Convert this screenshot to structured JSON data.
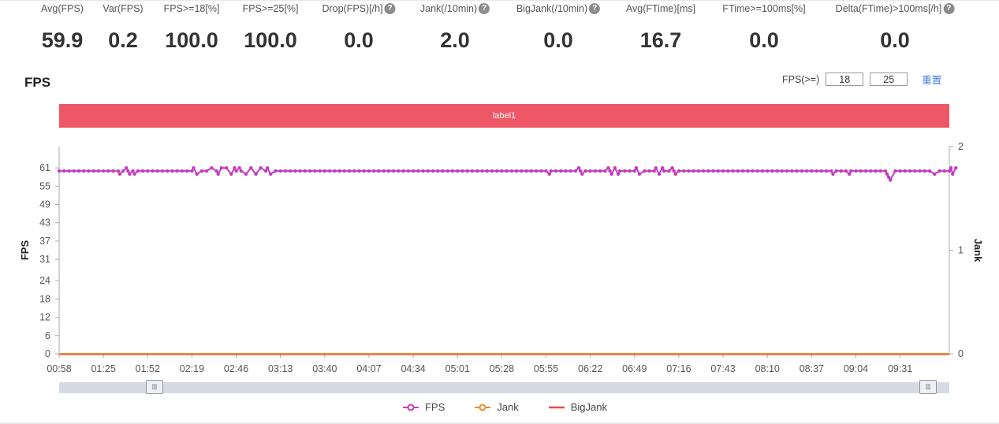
{
  "metrics": [
    {
      "label": "Avg(FPS)",
      "value": "59.9",
      "help": false,
      "cx": 79
    },
    {
      "label": "Var(FPS)",
      "value": "0.2",
      "help": false,
      "cx": 156
    },
    {
      "label": "FPS>=18[%]",
      "value": "100.0",
      "help": false,
      "cx": 243
    },
    {
      "label": "FPS>=25[%]",
      "value": "100.0",
      "help": false,
      "cx": 343
    },
    {
      "label": "Drop(FPS)[/h]",
      "value": "0.0",
      "help": true,
      "cx": 455
    },
    {
      "label": "Jank(/10min)",
      "value": "2.0",
      "help": true,
      "cx": 577
    },
    {
      "label": "BigJank(/10min)",
      "value": "0.0",
      "help": true,
      "cx": 708
    },
    {
      "label": "Avg(FTime)[ms]",
      "value": "16.7",
      "help": false,
      "cx": 838
    },
    {
      "label": "FTime>=100ms[%]",
      "value": "0.0",
      "help": false,
      "cx": 969
    },
    {
      "label": "Delta(FTime)>100ms[/h]",
      "value": "0.0",
      "help": true,
      "cx": 1135
    }
  ],
  "thresholds": {
    "label": "FPS(>=)",
    "low": "18",
    "high": "25",
    "reset": "重置"
  },
  "colors": {
    "fps": "#c43bbf",
    "jank": "#f08a2c",
    "bigjank": "#e84a3c",
    "band": "#ee5765",
    "axis": "#aaaaaa"
  },
  "chart_data": {
    "type": "line",
    "title": "FPS",
    "band_label": "label1",
    "ylabel": "FPS",
    "y2label": "Jank",
    "yticks": [
      0,
      6,
      12,
      18,
      24,
      31,
      37,
      43,
      49,
      55,
      61
    ],
    "ylim": [
      0,
      68
    ],
    "y2ticks": [
      0,
      1,
      2
    ],
    "y2lim": [
      0,
      2
    ],
    "xticks": [
      "00:58",
      "01:25",
      "01:52",
      "02:19",
      "02:46",
      "03:13",
      "03:40",
      "04:07",
      "04:34",
      "05:01",
      "05:28",
      "05:55",
      "06:22",
      "06:49",
      "07:16",
      "07:43",
      "08:10",
      "08:37",
      "09:04",
      "09:31"
    ],
    "x_range_sec": [
      58,
      601
    ],
    "grid": false,
    "legend_position": "bottom",
    "series": [
      {
        "name": "FPS",
        "axis": "left",
        "baseline": 60,
        "step_sec": 3,
        "deviations": [
          [
            95,
            59
          ],
          [
            99,
            61
          ],
          [
            101,
            59
          ],
          [
            104,
            59
          ],
          [
            140,
            61
          ],
          [
            142,
            59
          ],
          [
            151,
            61
          ],
          [
            155,
            59
          ],
          [
            157,
            61
          ],
          [
            160,
            61
          ],
          [
            163,
            59
          ],
          [
            165,
            61
          ],
          [
            168,
            61
          ],
          [
            172,
            59
          ],
          [
            175,
            61
          ],
          [
            178,
            59
          ],
          [
            181,
            61
          ],
          [
            185,
            61
          ],
          [
            187,
            59
          ],
          [
            357,
            59
          ],
          [
            375,
            61
          ],
          [
            377,
            59
          ],
          [
            393,
            61
          ],
          [
            395,
            59
          ],
          [
            397,
            61
          ],
          [
            399,
            59
          ],
          [
            410,
            61
          ],
          [
            412,
            59
          ],
          [
            422,
            61
          ],
          [
            424,
            59
          ],
          [
            426,
            61
          ],
          [
            432,
            61
          ],
          [
            434,
            59
          ],
          [
            530,
            59
          ],
          [
            540,
            59
          ],
          [
            563,
            59
          ],
          [
            564,
            58
          ],
          [
            565,
            57
          ],
          [
            592,
            59
          ],
          [
            602,
            61
          ],
          [
            603,
            59
          ],
          [
            605,
            61
          ]
        ]
      },
      {
        "name": "Jank",
        "axis": "right",
        "values": "all 0"
      },
      {
        "name": "BigJank",
        "axis": "right",
        "values": "all 0"
      }
    ]
  }
}
